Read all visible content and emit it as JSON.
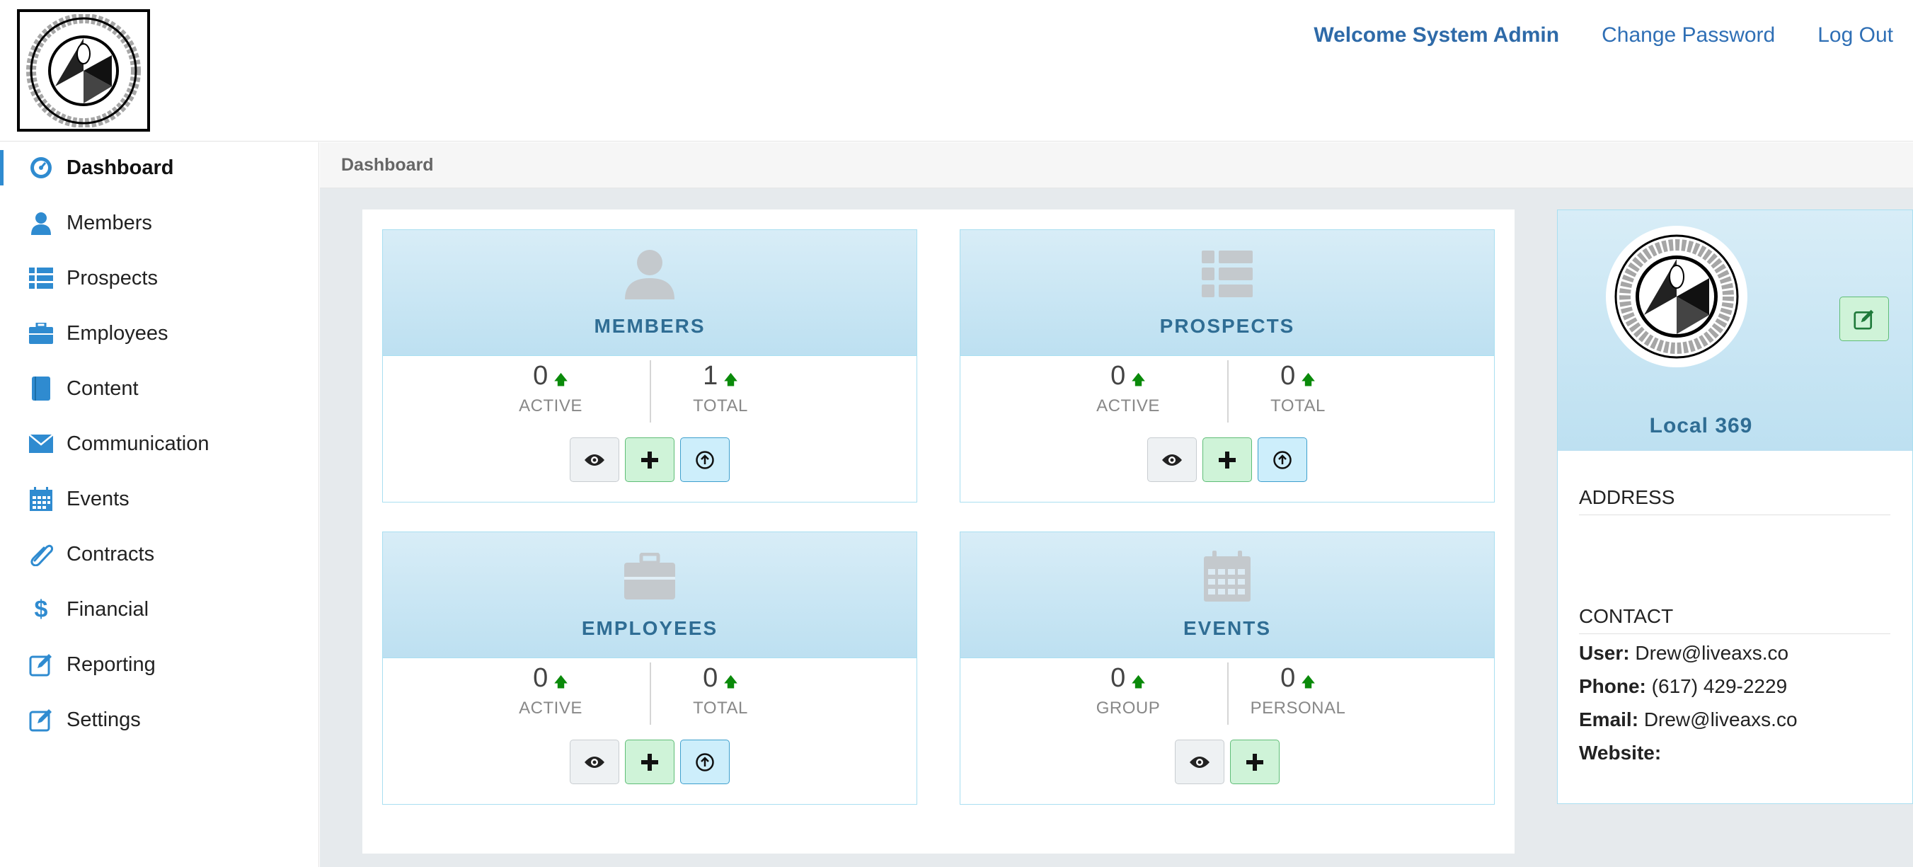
{
  "header": {
    "logo_alt": "UTILITY WORKERS UNION OF AMERICA AFL-CIO",
    "welcome": "Welcome System Admin",
    "change_password": "Change Password",
    "logout": "Log Out"
  },
  "sidebar": {
    "items": [
      {
        "label": "Dashboard",
        "icon": "dashboard-icon",
        "active": true
      },
      {
        "label": "Members",
        "icon": "user-icon"
      },
      {
        "label": "Prospects",
        "icon": "list-icon"
      },
      {
        "label": "Employees",
        "icon": "briefcase-icon"
      },
      {
        "label": "Content",
        "icon": "book-icon"
      },
      {
        "label": "Communication",
        "icon": "envelope-icon"
      },
      {
        "label": "Events",
        "icon": "calendar-icon"
      },
      {
        "label": "Contracts",
        "icon": "paperclip-icon"
      },
      {
        "label": "Financial",
        "icon": "dollar-icon"
      },
      {
        "label": "Reporting",
        "icon": "edit-icon"
      },
      {
        "label": "Settings",
        "icon": "edit-icon"
      }
    ]
  },
  "breadcrumb": "Dashboard",
  "cards": {
    "members": {
      "title": "MEMBERS",
      "left_value": "0",
      "left_label": "ACTIVE",
      "right_value": "1",
      "right_label": "TOTAL"
    },
    "prospects": {
      "title": "PROSPECTS",
      "left_value": "0",
      "left_label": "ACTIVE",
      "right_value": "0",
      "right_label": "TOTAL"
    },
    "employees": {
      "title": "EMPLOYEES",
      "left_value": "0",
      "left_label": "ACTIVE",
      "right_value": "0",
      "right_label": "TOTAL"
    },
    "events": {
      "title": "EVENTS",
      "left_value": "0",
      "left_label": "GROUP",
      "right_value": "0",
      "right_label": "PERSONAL"
    }
  },
  "profile": {
    "local_name": "Local 369",
    "address_title": "ADDRESS",
    "contact_title": "CONTACT",
    "user_label": "User:",
    "user_value": "Drew@liveaxs.co",
    "phone_label": "Phone:",
    "phone_value": "(617) 429-2229",
    "email_label": "Email:",
    "email_value": "Drew@liveaxs.co",
    "website_label": "Website:",
    "website_value": ""
  },
  "colors": {
    "accent": "#2f6fb5",
    "card_header": "#c9e6f4",
    "card_title": "#2f6d94",
    "up_arrow": "#0a8a0a",
    "add_button": "#cff3d8",
    "upload_button": "#cdeefb"
  }
}
